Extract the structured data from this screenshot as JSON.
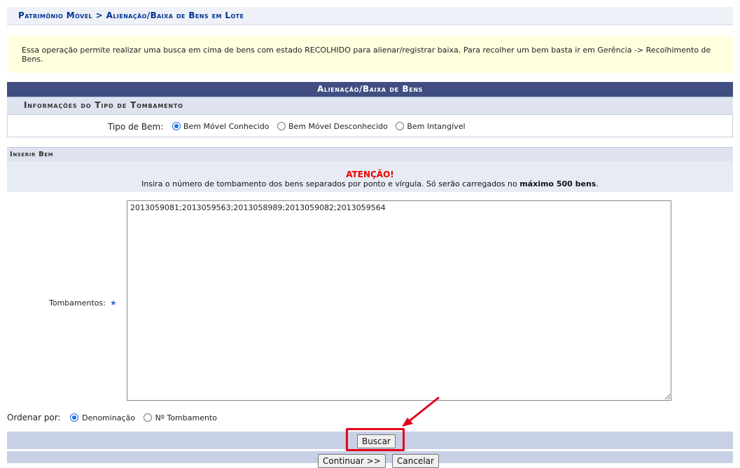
{
  "breadcrumb": "Patrimônio Móvel > Alienação/Baixa de Bens em Lote",
  "info_message": "Essa operação permite realizar uma busca em cima de bens com estado RECOLHIDO para alienar/registrar baixa. Para recolher um bem basta ir em Gerência -> Recolhimento de Bens.",
  "form": {
    "caption": "Alienação/Baixa de Bens",
    "tipo_section_title": "Informações do Tipo de Tombamento",
    "tipo_label": "Tipo de Bem:",
    "tipo_options": [
      "Bem Móvel Conhecido",
      "Bem Móvel Desconhecido",
      "Bem Intangível"
    ],
    "tipo_selected": "Bem Móvel Conhecido",
    "inserir_section_title": "Inserir Bem",
    "atencao_title": "ATENÇÃO!",
    "atencao_text_before": "Insira o número de tombamento dos bens separados por ponto e vírgula. Só serão carregados no ",
    "atencao_text_bold": "máximo 500 bens",
    "atencao_text_after": ".",
    "tombamentos_label": "Tombamentos:",
    "required_mark": "★",
    "tombamentos_value": "2013059081;2013059563;2013058989;2013059082;2013059564",
    "ordenar_label": "Ordenar por:",
    "ordenar_options": [
      "Denominação",
      "Nº Tombamento"
    ],
    "ordenar_selected": "Denominação",
    "buscar_label": "Buscar",
    "continuar_label": "Continuar >>",
    "cancelar_label": "Cancelar"
  },
  "colors": {
    "header_dark": "#404e82",
    "subheader": "#dee3ef",
    "info_bg": "#fffedf",
    "highlight": "#e3001b",
    "breadcrumb_text": "#003390"
  }
}
